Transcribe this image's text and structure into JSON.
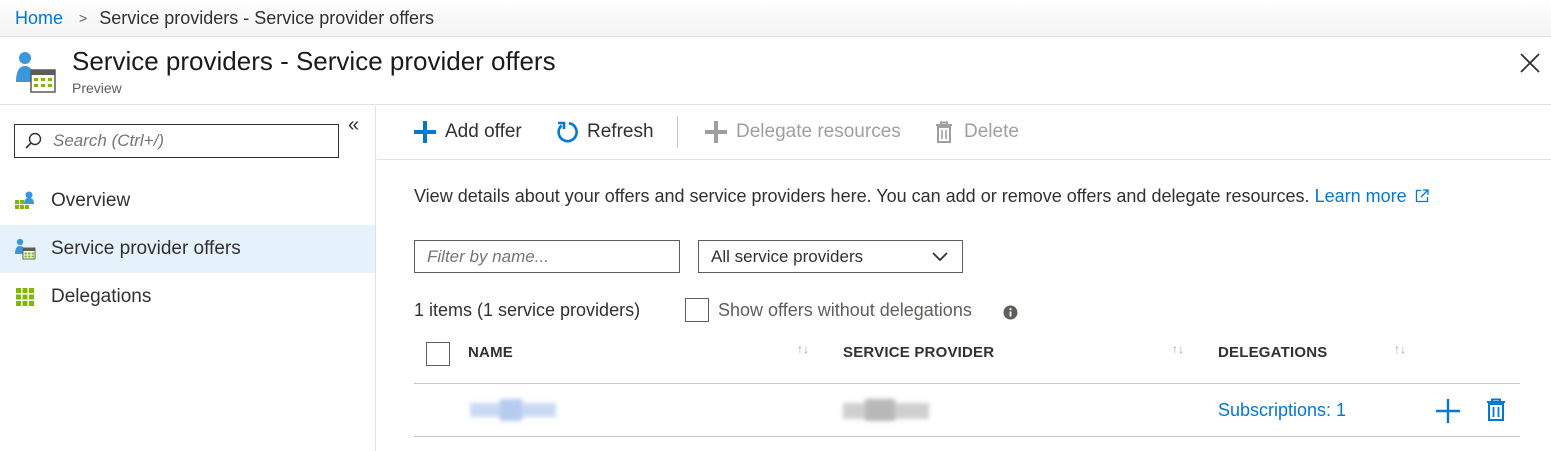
{
  "breadcrumb": {
    "home": "Home",
    "separator": ">",
    "current": "Service providers - Service provider offers"
  },
  "header": {
    "title": "Service providers - Service provider offers",
    "subtitle": "Preview",
    "icon": "service-provider-offers-icon",
    "close_icon": "close-icon"
  },
  "sidebar": {
    "search_placeholder": "Search (Ctrl+/)",
    "collapse_icon": "double-chevron-left-icon",
    "items": [
      {
        "label": "Overview",
        "icon": "overview-icon",
        "active": false
      },
      {
        "label": "Service provider offers",
        "icon": "service-provider-offers-icon",
        "active": true
      },
      {
        "label": "Delegations",
        "icon": "delegations-grid-icon",
        "active": false
      }
    ]
  },
  "toolbar": {
    "add_offer": "Add offer",
    "refresh": "Refresh",
    "delegate_resources": "Delegate resources",
    "delete": "Delete"
  },
  "content": {
    "description": "View details about your offers and service providers here. You can add or remove offers and delegate resources.",
    "learn_more": "Learn more",
    "filter_placeholder": "Filter by name...",
    "provider_filter_value": "All service providers",
    "items_count": "1 items (1 service providers)",
    "show_without_delegations": "Show offers without delegations"
  },
  "table": {
    "columns": [
      "NAME",
      "SERVICE PROVIDER",
      "DELEGATIONS"
    ],
    "rows": [
      {
        "name": "",
        "service_provider": "",
        "delegations": "Subscriptions: 1"
      }
    ]
  },
  "colors": {
    "accent": "#0078d4",
    "active_nav_bg": "#e6f2fb",
    "disabled": "#a19f9d"
  }
}
